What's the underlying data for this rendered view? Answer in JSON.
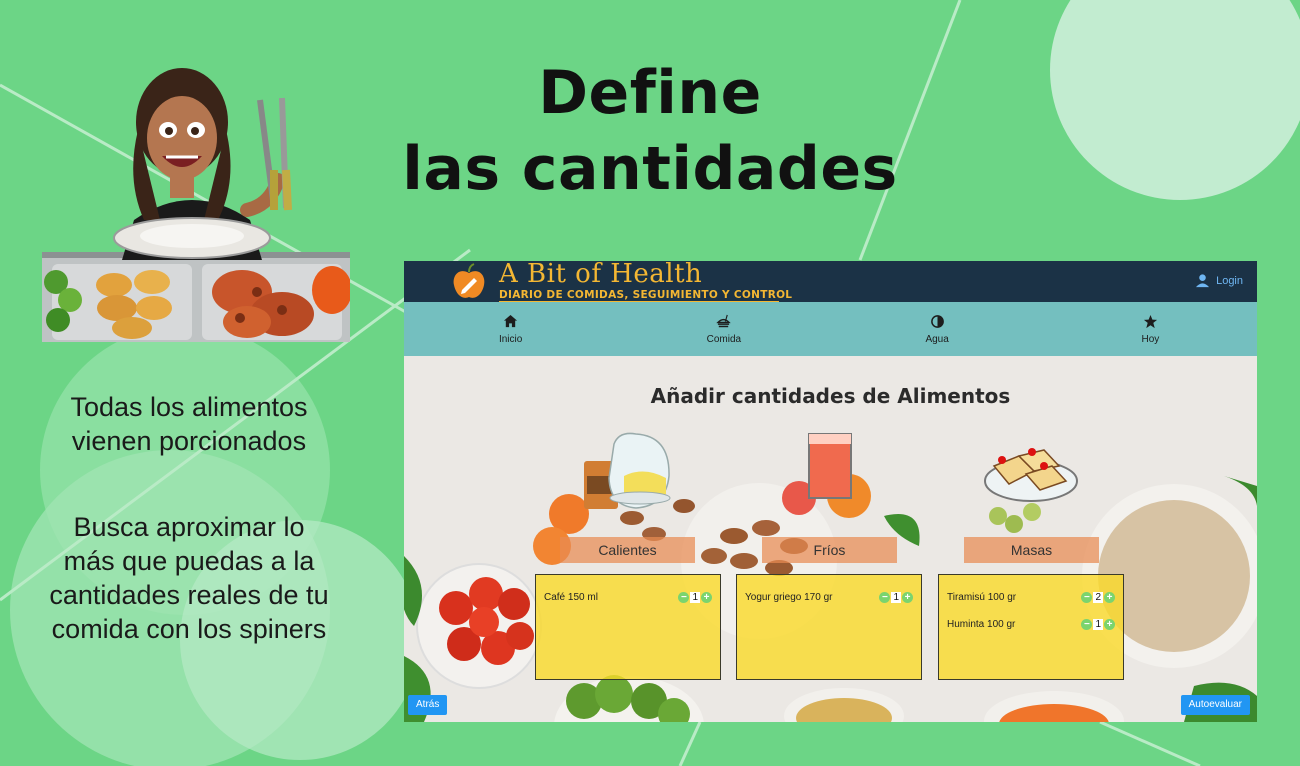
{
  "slide": {
    "title_line1": "Define",
    "title_line2": "las cantidades",
    "text_block1": "Todas los alimentos vienen porcionados",
    "text_block2": "Busca aproximar lo más que puedas a la cantidades reales de tu comida con los spiners"
  },
  "app": {
    "brand_name": "A Bit of Health",
    "brand_subtitle": "DIARIO DE COMIDAS, SEGUIMIENTO Y CONTROL",
    "login_label": "Login",
    "nav": [
      {
        "label": "Inicio",
        "icon": "home-icon"
      },
      {
        "label": "Comida",
        "icon": "food-icon"
      },
      {
        "label": "Agua",
        "icon": "contrast-icon"
      },
      {
        "label": "Hoy",
        "icon": "star-icon"
      }
    ],
    "section_title": "Añadir cantidades de Alimentos",
    "categories": [
      {
        "label": "Calientes",
        "items": [
          {
            "name": "Café 150 ml",
            "qty": "1"
          }
        ]
      },
      {
        "label": "Fríos",
        "items": [
          {
            "name": "Yogur griego 170 gr",
            "qty": "1"
          }
        ]
      },
      {
        "label": "Masas",
        "items": [
          {
            "name": "Tiramisú 100 gr",
            "qty": "2"
          },
          {
            "name": "Huminta 100 gr",
            "qty": "1"
          }
        ]
      }
    ],
    "back_label": "Atrás",
    "evaluate_label": "Autoevaluar",
    "colors": {
      "header": "#1b3246",
      "nav": "#74bfbf",
      "brand": "#f4b733",
      "accent_button": "#2196f3",
      "panel": "#fada28"
    }
  }
}
